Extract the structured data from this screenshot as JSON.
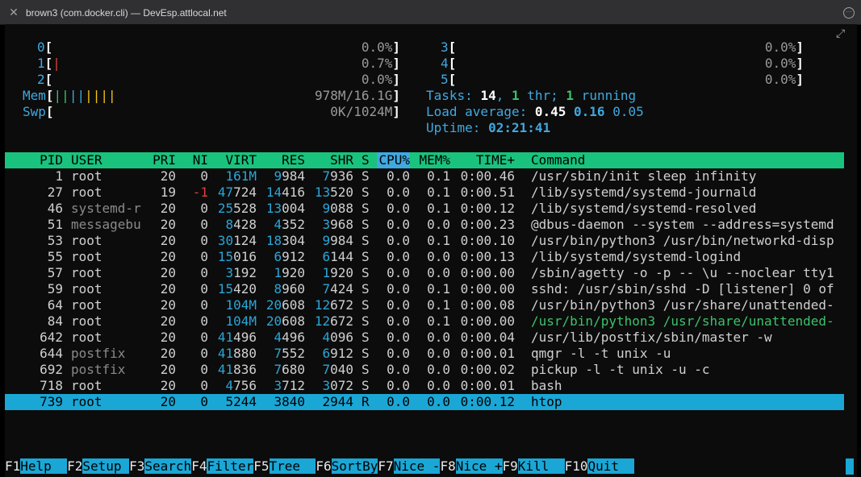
{
  "window": {
    "title": "brown3 (com.docker.cli) — DevEsp.attlocal.net"
  },
  "cpus": [
    {
      "id": "0",
      "bar": "",
      "pct": "0.0%"
    },
    {
      "id": "1",
      "bar": "|",
      "pct": "0.7%"
    },
    {
      "id": "2",
      "bar": "",
      "pct": "0.0%"
    },
    {
      "id": "3",
      "bar": "",
      "pct": "0.0%"
    },
    {
      "id": "4",
      "bar": "",
      "pct": "0.0%"
    },
    {
      "id": "5",
      "bar": "",
      "pct": "0.0%"
    }
  ],
  "mem": {
    "label": "Mem",
    "bar_grn": "||",
    "bar_blu": "||",
    "bar_yel": "||||",
    "value": "978M/16.1G"
  },
  "swp": {
    "label": "Swp",
    "value": "0K/1024M"
  },
  "tasks": {
    "label": "Tasks: ",
    "count": "14",
    "sep1": ", ",
    "thr": "1",
    "thr_label": " thr; ",
    "running": "1",
    "running_label": " running"
  },
  "load": {
    "label": "Load average: ",
    "l1": "0.45",
    "l5": "0.16",
    "l15": "0.05"
  },
  "uptime": {
    "label": "Uptime: ",
    "value": "02:21:41"
  },
  "columns": {
    "pid": "PID",
    "user": "USER",
    "pri": "PRI",
    "ni": "NI",
    "virt": "VIRT",
    "res": "RES",
    "shr": "SHR",
    "s": "S",
    "cpu": "CPU%",
    "mem": "MEM%",
    "time": "TIME+",
    "cmd": "Command"
  },
  "processes": [
    {
      "pid": "1",
      "user": "root",
      "pri": "20",
      "ni": "0",
      "virt": "161M",
      "res": "9984",
      "shr": "7936",
      "s": "S",
      "cpu": "0.0",
      "mem": "0.1",
      "time": "0:00.46",
      "cmd": "/usr/sbin/init sleep infinity"
    },
    {
      "pid": "27",
      "user": "root",
      "pri": "19",
      "ni": "-1",
      "virt": "47724",
      "res": "14416",
      "shr": "13520",
      "s": "S",
      "cpu": "0.0",
      "mem": "0.1",
      "time": "0:00.51",
      "cmd": "/lib/systemd/systemd-journald"
    },
    {
      "pid": "46",
      "user": "systemd-r",
      "pri": "20",
      "ni": "0",
      "virt": "25528",
      "res": "13004",
      "shr": "9088",
      "s": "S",
      "cpu": "0.0",
      "mem": "0.1",
      "time": "0:00.12",
      "cmd": "/lib/systemd/systemd-resolved"
    },
    {
      "pid": "51",
      "user": "messagebu",
      "pri": "20",
      "ni": "0",
      "virt": "8428",
      "res": "4352",
      "shr": "3968",
      "s": "S",
      "cpu": "0.0",
      "mem": "0.0",
      "time": "0:00.23",
      "cmd": "@dbus-daemon --system --address=systemd"
    },
    {
      "pid": "53",
      "user": "root",
      "pri": "20",
      "ni": "0",
      "virt": "30124",
      "res": "18304",
      "shr": "9984",
      "s": "S",
      "cpu": "0.0",
      "mem": "0.1",
      "time": "0:00.10",
      "cmd": "/usr/bin/python3 /usr/bin/networkd-disp"
    },
    {
      "pid": "55",
      "user": "root",
      "pri": "20",
      "ni": "0",
      "virt": "15016",
      "res": "6912",
      "shr": "6144",
      "s": "S",
      "cpu": "0.0",
      "mem": "0.0",
      "time": "0:00.13",
      "cmd": "/lib/systemd/systemd-logind"
    },
    {
      "pid": "57",
      "user": "root",
      "pri": "20",
      "ni": "0",
      "virt": "3192",
      "res": "1920",
      "shr": "1920",
      "s": "S",
      "cpu": "0.0",
      "mem": "0.0",
      "time": "0:00.00",
      "cmd": "/sbin/agetty -o -p -- \\u --noclear tty1"
    },
    {
      "pid": "59",
      "user": "root",
      "pri": "20",
      "ni": "0",
      "virt": "15420",
      "res": "8960",
      "shr": "7424",
      "s": "S",
      "cpu": "0.0",
      "mem": "0.1",
      "time": "0:00.00",
      "cmd": "sshd: /usr/sbin/sshd -D [listener] 0 of"
    },
    {
      "pid": "64",
      "user": "root",
      "pri": "20",
      "ni": "0",
      "virt": "104M",
      "res": "20608",
      "shr": "12672",
      "s": "S",
      "cpu": "0.0",
      "mem": "0.1",
      "time": "0:00.08",
      "cmd": "/usr/bin/python3 /usr/share/unattended-"
    },
    {
      "pid": "84",
      "user": "root",
      "pri": "20",
      "ni": "0",
      "virt": "104M",
      "res": "20608",
      "shr": "12672",
      "s": "S",
      "cpu": "0.0",
      "mem": "0.1",
      "time": "0:00.00",
      "cmd": "/usr/bin/python3 /usr/share/unattended-"
    },
    {
      "pid": "642",
      "user": "root",
      "pri": "20",
      "ni": "0",
      "virt": "41496",
      "res": "4496",
      "shr": "4096",
      "s": "S",
      "cpu": "0.0",
      "mem": "0.0",
      "time": "0:00.04",
      "cmd": "/usr/lib/postfix/sbin/master -w"
    },
    {
      "pid": "644",
      "user": "postfix",
      "pri": "20",
      "ni": "0",
      "virt": "41880",
      "res": "7552",
      "shr": "6912",
      "s": "S",
      "cpu": "0.0",
      "mem": "0.0",
      "time": "0:00.01",
      "cmd": "qmgr -l -t unix -u"
    },
    {
      "pid": "692",
      "user": "postfix",
      "pri": "20",
      "ni": "0",
      "virt": "41836",
      "res": "7680",
      "shr": "7040",
      "s": "S",
      "cpu": "0.0",
      "mem": "0.0",
      "time": "0:00.02",
      "cmd": "pickup -l -t unix -u -c"
    },
    {
      "pid": "718",
      "user": "root",
      "pri": "20",
      "ni": "0",
      "virt": "4756",
      "res": "3712",
      "shr": "3072",
      "s": "S",
      "cpu": "0.0",
      "mem": "0.0",
      "time": "0:00.01",
      "cmd": "bash"
    },
    {
      "pid": "739",
      "user": "root",
      "pri": "20",
      "ni": "0",
      "virt": "5244",
      "res": "3840",
      "shr": "2944",
      "s": "R",
      "cpu": "0.0",
      "mem": "0.0",
      "time": "0:00.12",
      "cmd": "htop"
    }
  ],
  "footer": [
    {
      "key": "F1",
      "label": "Help  "
    },
    {
      "key": "F2",
      "label": "Setup "
    },
    {
      "key": "F3",
      "label": "Search"
    },
    {
      "key": "F4",
      "label": "Filter"
    },
    {
      "key": "F5",
      "label": "Tree  "
    },
    {
      "key": "F6",
      "label": "SortBy"
    },
    {
      "key": "F7",
      "label": "Nice -"
    },
    {
      "key": "F8",
      "label": "Nice +"
    },
    {
      "key": "F9",
      "label": "Kill  "
    },
    {
      "key": "F10",
      "label": "Quit  "
    }
  ],
  "colors": {
    "accent": "#1aa7d6",
    "header": "#19c37d",
    "cyan": "#3fa9e0",
    "red": "#e0403a"
  }
}
